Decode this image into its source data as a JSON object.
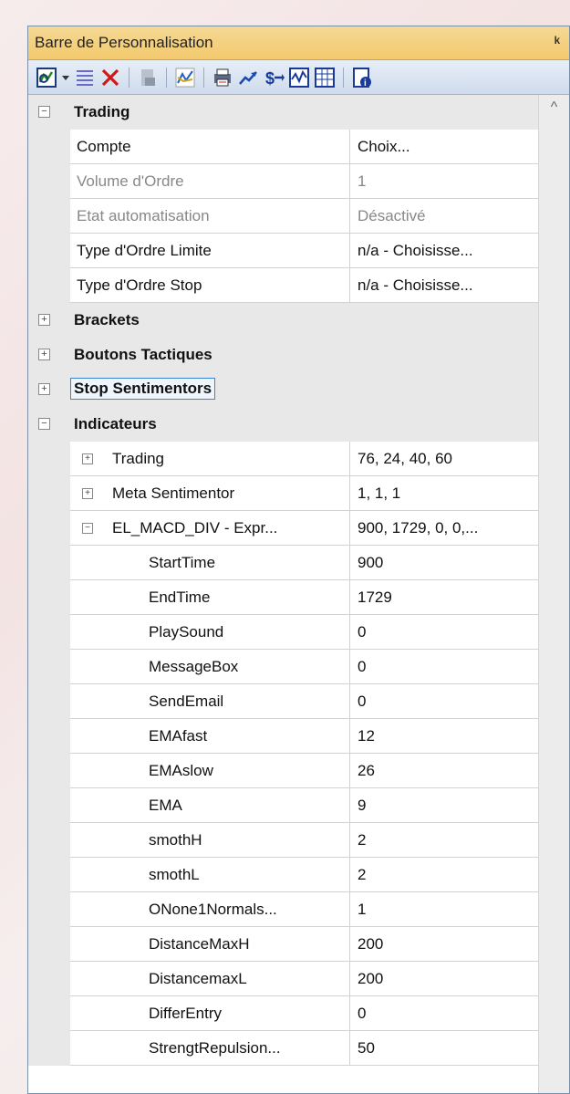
{
  "panel": {
    "title": "Barre de Personnalisation",
    "pin_glyph": "ᵖ"
  },
  "toolbar": {
    "icons": [
      "add-indicator-icon",
      "dropdown-arrow-icon",
      "list-lines-icon",
      "delete-icon",
      "disabled-chart-icon",
      "line-chart-icon",
      "printer-icon",
      "trend-icon",
      "dollar-arrow-icon",
      "histogram-icon",
      "grid-table-icon",
      "properties-icon"
    ]
  },
  "grid": {
    "trading": {
      "title": "Trading",
      "props": [
        {
          "name": "Compte",
          "value": "Choix..."
        },
        {
          "name": "Volume d'Ordre",
          "value": "1"
        },
        {
          "name": "Etat automatisation",
          "value": "Désactivé"
        },
        {
          "name": "Type d'Ordre Limite",
          "value": "n/a - Choisisse..."
        },
        {
          "name": "Type d'Ordre Stop",
          "value": "n/a - Choisisse..."
        }
      ]
    },
    "brackets": "Brackets",
    "boutons": "Boutons Tactiques",
    "stop": "Stop Sentimentors",
    "indicateurs": {
      "title": "Indicateurs",
      "subs": [
        {
          "name": "Trading",
          "value": "76, 24, 40, 60"
        },
        {
          "name": "Meta Sentimentor",
          "value": "1, 1, 1"
        },
        {
          "name": "EL_MACD_DIV - Expr...",
          "value": "900, 1729, 0, 0,..."
        }
      ],
      "leaves": [
        {
          "name": "StartTime",
          "value": "900"
        },
        {
          "name": "EndTime",
          "value": "1729"
        },
        {
          "name": "PlaySound",
          "value": "0"
        },
        {
          "name": "MessageBox",
          "value": "0"
        },
        {
          "name": "SendEmail",
          "value": "0"
        },
        {
          "name": "EMAfast",
          "value": "12"
        },
        {
          "name": "EMAslow",
          "value": "26"
        },
        {
          "name": "EMA",
          "value": "9"
        },
        {
          "name": "smothH",
          "value": "2"
        },
        {
          "name": "smothL",
          "value": "2"
        },
        {
          "name": "ONone1Normals...",
          "value": "1"
        },
        {
          "name": "DistanceMaxH",
          "value": "200"
        },
        {
          "name": "DistancemaxL",
          "value": "200"
        },
        {
          "name": "DifferEntry",
          "value": "0"
        },
        {
          "name": "StrengtRepulsion...",
          "value": "50"
        }
      ]
    }
  },
  "symbols": {
    "minus": "−",
    "plus": "+",
    "scroll_up": "^"
  }
}
